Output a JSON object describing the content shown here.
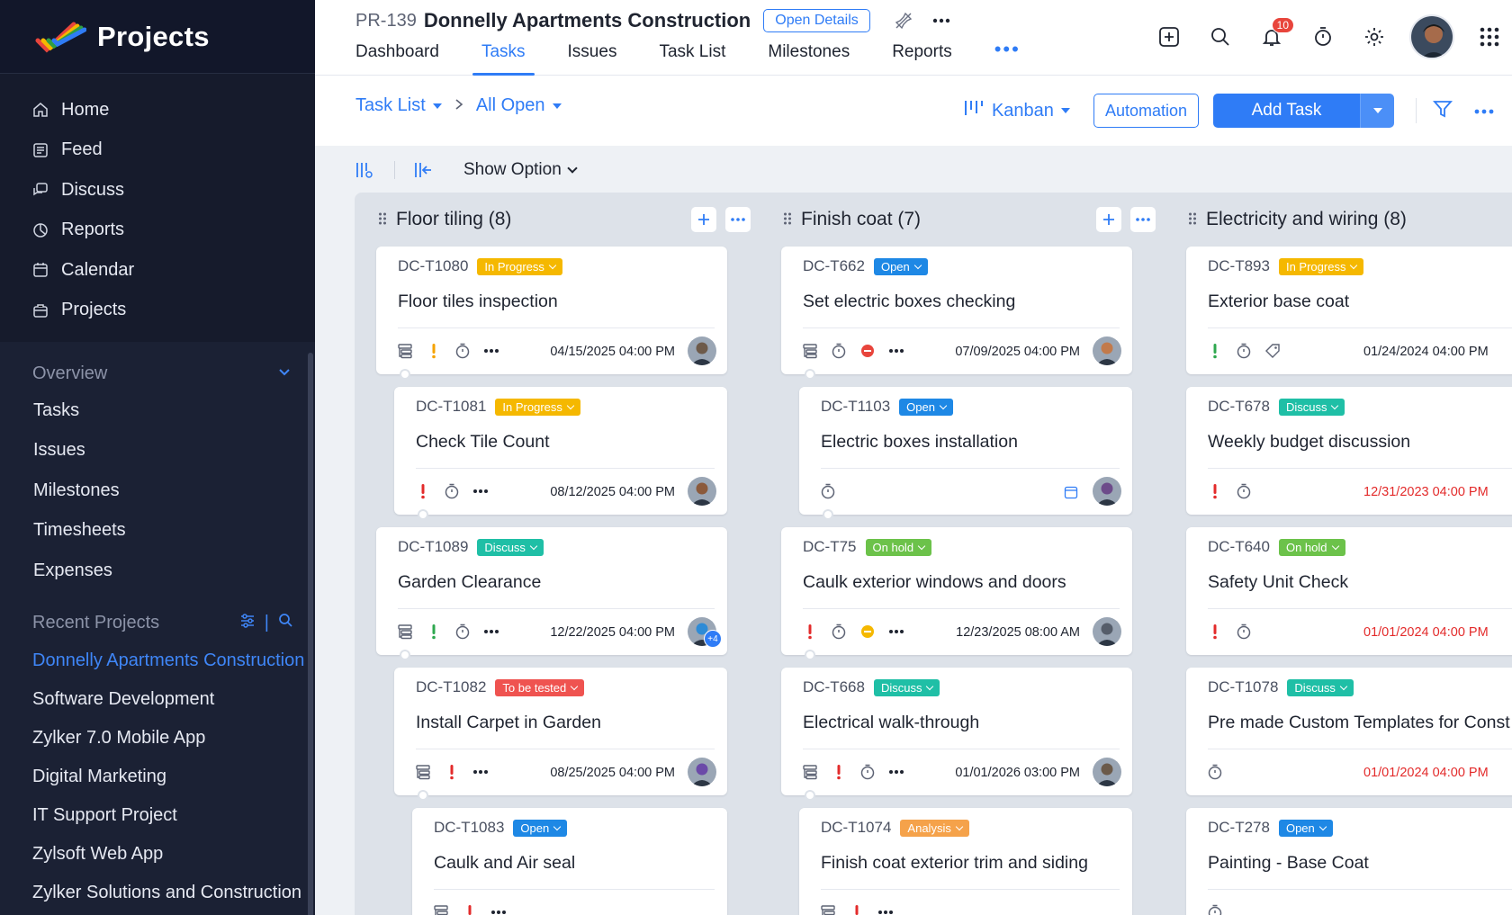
{
  "app": {
    "name": "Projects"
  },
  "nav": {
    "items": [
      {
        "label": "Home",
        "icon": "home-icon"
      },
      {
        "label": "Feed",
        "icon": "feed-icon"
      },
      {
        "label": "Discuss",
        "icon": "discuss-icon"
      },
      {
        "label": "Reports",
        "icon": "reports-icon"
      },
      {
        "label": "Calendar",
        "icon": "calendar-icon"
      },
      {
        "label": "Projects",
        "icon": "projects-icon"
      }
    ]
  },
  "overview": {
    "title": "Overview",
    "items": [
      "Tasks",
      "Issues",
      "Milestones",
      "Timesheets",
      "Expenses"
    ]
  },
  "recent": {
    "title": "Recent Projects",
    "items": [
      "Donnelly Apartments Construction",
      "Software Development",
      "Zylker 7.0 Mobile App",
      "Digital Marketing",
      "IT Support Project",
      "Zylsoft Web App",
      "Zylker Solutions and Construction"
    ]
  },
  "project": {
    "id": "PR-139",
    "title": "Donnelly Apartments Construction",
    "open_details": "Open Details"
  },
  "tabs": [
    "Dashboard",
    "Tasks",
    "Issues",
    "Task List",
    "Milestones",
    "Reports"
  ],
  "notifications": {
    "count": "10"
  },
  "toolbar": {
    "crumb1": "Task List",
    "crumb2": "All Open",
    "view": "Kanban",
    "automation": "Automation",
    "add_task": "Add Task",
    "show_option": "Show Option"
  },
  "colors": {
    "accent": "#2f7cf6",
    "in_progress": "#f5b800",
    "open": "#1e88e5",
    "discuss": "#1fbfa6",
    "on_hold": "#6cc24a",
    "to_be_tested": "#ef5350",
    "analysis": "#f5a24a"
  },
  "columns": [
    {
      "title": "Floor tiling (8)",
      "cards": [
        {
          "id": "DC-T1080",
          "status": "In Progress",
          "name": "Floor tiles inspection",
          "date": "04/15/2025 04:00 PM"
        },
        {
          "id": "DC-T1081",
          "status": "In Progress",
          "name": "Check Tile Count",
          "date": "08/12/2025 04:00 PM"
        },
        {
          "id": "DC-T1089",
          "status": "Discuss",
          "name": "Garden Clearance",
          "date": "12/22/2025 04:00 PM",
          "extra": "+4"
        },
        {
          "id": "DC-T1082",
          "status": "To be tested",
          "name": "Install Carpet in Garden",
          "date": "08/25/2025 04:00 PM"
        },
        {
          "id": "DC-T1083",
          "status": "Open",
          "name": "Caulk and Air seal",
          "date": ""
        }
      ]
    },
    {
      "title": "Finish coat (7)",
      "cards": [
        {
          "id": "DC-T662",
          "status": "Open",
          "name": "Set electric boxes checking",
          "date": "07/09/2025 04:00 PM"
        },
        {
          "id": "DC-T1103",
          "status": "Open",
          "name": "Electric boxes installation",
          "date": ""
        },
        {
          "id": "DC-T75",
          "status": "On hold",
          "name": "Caulk exterior windows and doors",
          "date": "12/23/2025 08:00 AM"
        },
        {
          "id": "DC-T668",
          "status": "Discuss",
          "name": "Electrical walk-through",
          "date": "01/01/2026 03:00 PM"
        },
        {
          "id": "DC-T1074",
          "status": "Analysis",
          "name": "Finish coat exterior trim and siding",
          "date": ""
        }
      ]
    },
    {
      "title": "Electricity and wiring (8)",
      "cards": [
        {
          "id": "DC-T893",
          "status": "In Progress",
          "name": "Exterior base coat",
          "date": "01/24/2024 04:00 PM"
        },
        {
          "id": "DC-T678",
          "status": "Discuss",
          "name": "Weekly budget discussion",
          "date": "12/31/2023 04:00 PM"
        },
        {
          "id": "DC-T640",
          "status": "On hold",
          "name": "Safety Unit Check",
          "date": "01/01/2024 04:00 PM"
        },
        {
          "id": "DC-T1078",
          "status": "Discuss",
          "name": "Pre made Custom Templates for Construction",
          "date": "01/01/2024 04:00 PM"
        },
        {
          "id": "DC-T278",
          "status": "Open",
          "name": "Painting - Base Coat",
          "date": ""
        }
      ]
    }
  ]
}
